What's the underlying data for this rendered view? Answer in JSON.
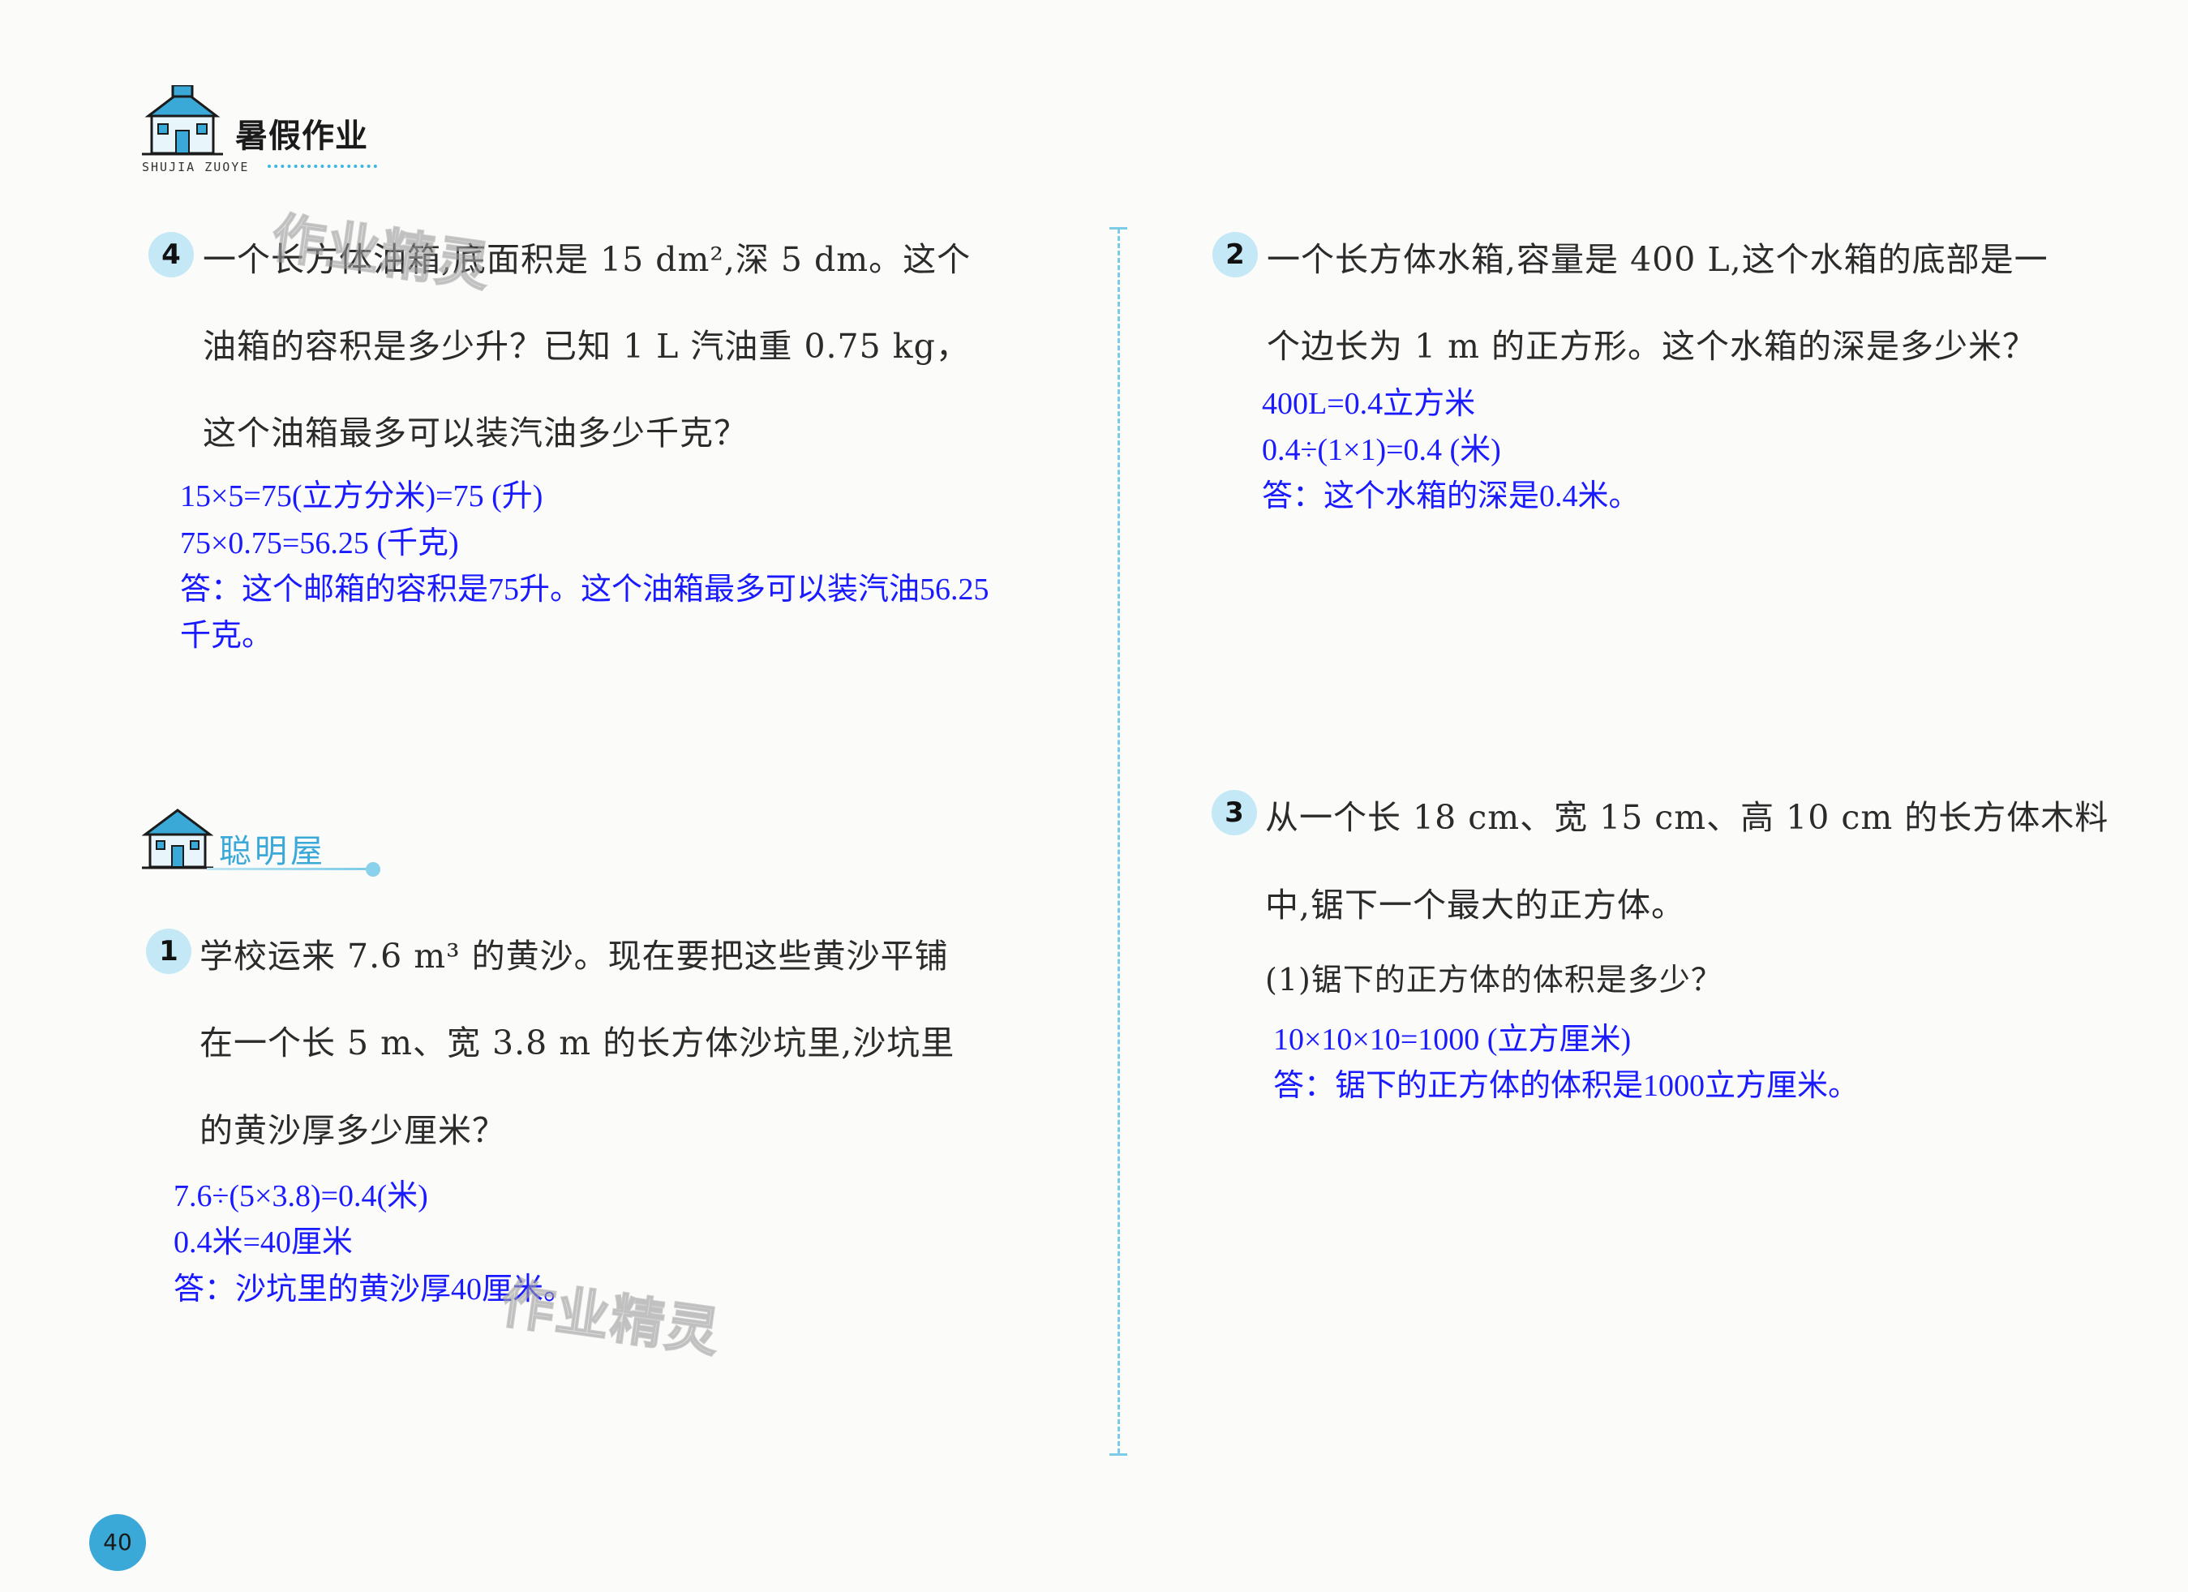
{
  "header": {
    "title": "暑假作业",
    "pinyin": "SHUJIA ZUOYE"
  },
  "watermark": "作业精灵",
  "problem4": {
    "number": "4",
    "lines": [
      "一个长方体油箱,底面积是 15 dm²,深 5 dm。这个",
      "油箱的容积是多少升？已知 1 L 汽油重 0.75 kg，",
      "这个油箱最多可以装汽油多少千克？"
    ],
    "answers": [
      "15×5=75(立方分米)=75 (升)",
      "75×0.75=56.25 (千克)",
      "答：这个邮箱的容积是75升。这个油箱最多可以装汽油56.25",
      "千克。"
    ]
  },
  "section": {
    "label": "聪明屋"
  },
  "problem1": {
    "number": "1",
    "lines": [
      "学校运来 7.6 m³ 的黄沙。现在要把这些黄沙平铺",
      "在一个长 5 m、宽 3.8 m 的长方体沙坑里,沙坑里",
      "的黄沙厚多少厘米？"
    ],
    "answers": [
      "7.6÷(5×3.8)=0.4(米)",
      "0.4米=40厘米",
      "答：沙坑里的黄沙厚40厘米。"
    ]
  },
  "problem2": {
    "number": "2",
    "lines": [
      "一个长方体水箱,容量是 400 L,这个水箱的底部是一",
      "个边长为 1 m 的正方形。这个水箱的深是多少米？"
    ],
    "answers": [
      "400L=0.4立方米",
      "0.4÷(1×1)=0.4 (米)",
      "答：这个水箱的深是0.4米。"
    ]
  },
  "problem3": {
    "number": "3",
    "lines": [
      "从一个长 18 cm、宽 15 cm、高 10 cm 的长方体木料",
      "中,锯下一个最大的正方体。"
    ],
    "sub": "(1)锯下的正方体的体积是多少？",
    "answers": [
      "10×10×10=1000 (立方厘米)",
      "答：锯下的正方体的体积是1000立方厘米。"
    ]
  },
  "page_number": "40",
  "colors": {
    "accent": "#3aa9d8",
    "answer": "#1a1aff",
    "badge": "#c5e8f6"
  }
}
